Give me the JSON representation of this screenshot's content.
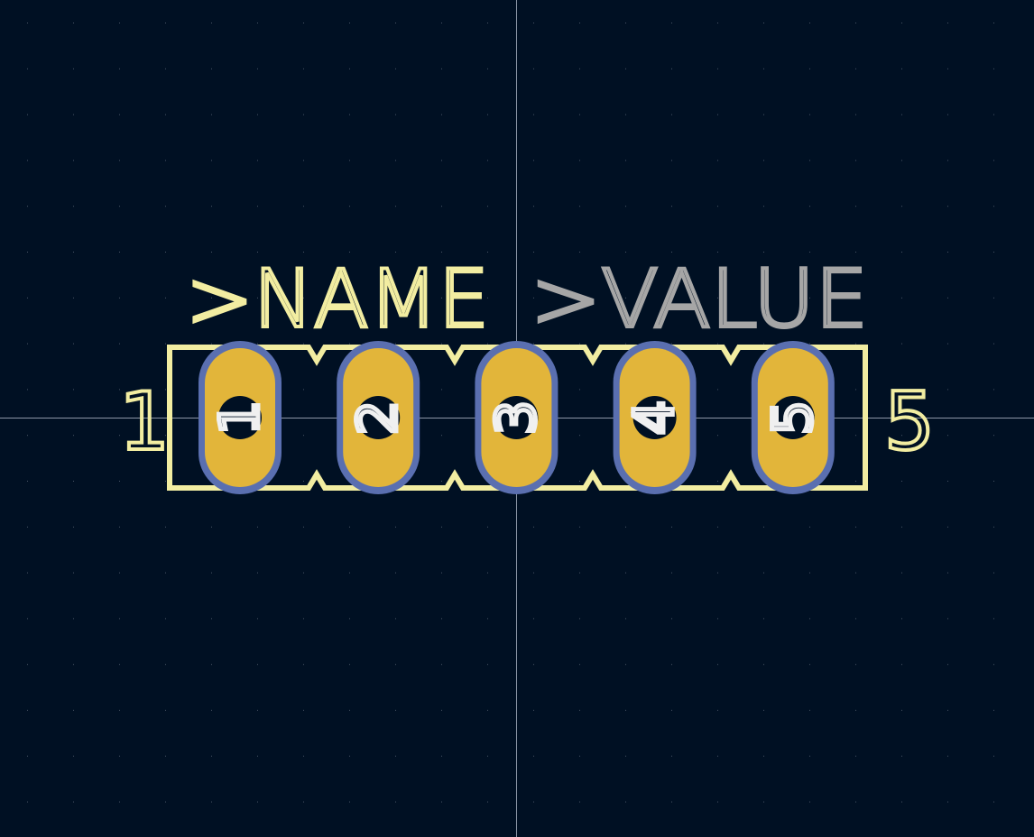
{
  "colors": {
    "background": "#001023",
    "grid": "#4a5566",
    "crosshair": "#8c96a6",
    "silkscreen": "#f2eda1",
    "fab_value": "#a6a6a6",
    "pad_copper": "#e2b53a",
    "pad_outline": "#5a6fb0",
    "drill_hole": "#001023",
    "pad_number": "#f0f0f0"
  },
  "footprint": {
    "reference_text": ">NAME",
    "value_text": ">VALUE",
    "first_pin_label": "1",
    "last_pin_label": "5",
    "pad_count": 5,
    "pads": [
      {
        "number": "1"
      },
      {
        "number": "2"
      },
      {
        "number": "3"
      },
      {
        "number": "4"
      },
      {
        "number": "5"
      }
    ]
  }
}
